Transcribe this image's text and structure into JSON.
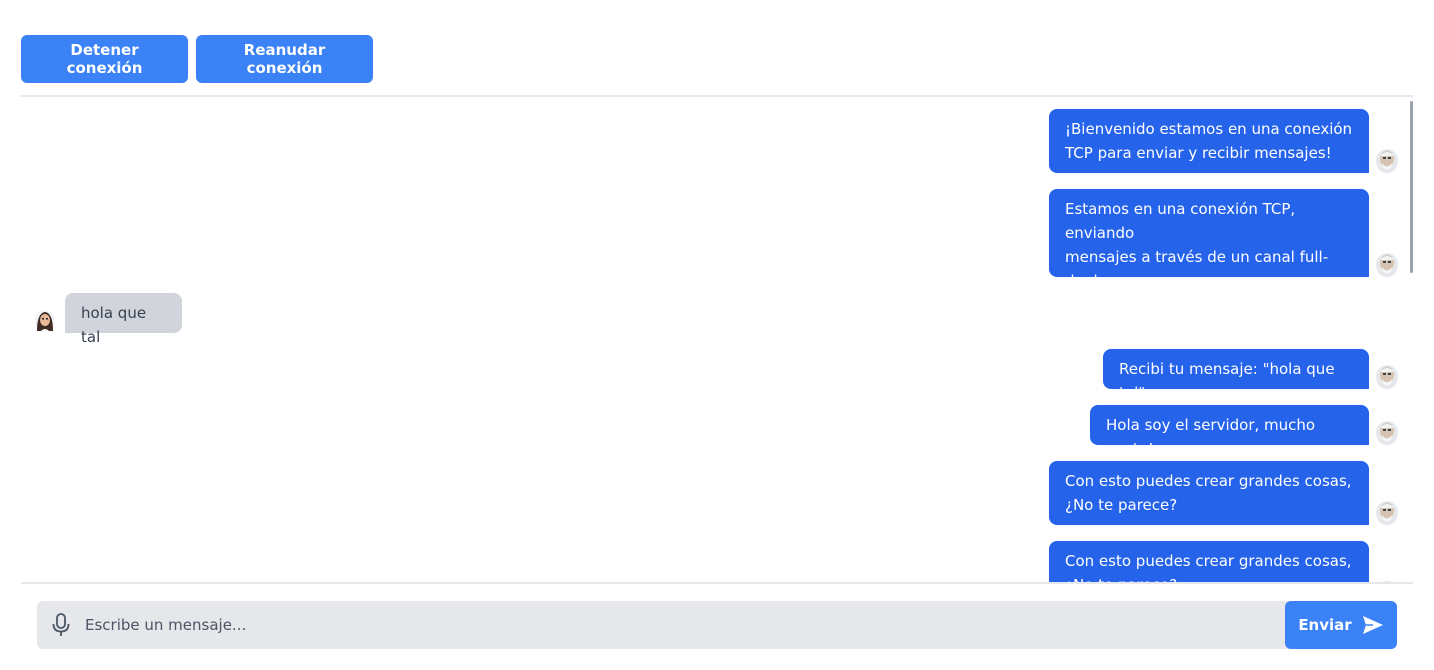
{
  "toolbar": {
    "stop_label": "Detener conexión",
    "resume_label": "Reanudar conexión"
  },
  "messages": [
    {
      "from": "server",
      "lines": [
        "¡Bienvenido estamos en una conexión",
        "TCP para enviar y recibir mensajes!"
      ]
    },
    {
      "from": "server",
      "lines": [
        "Estamos en una conexión TCP, enviando",
        "mensajes a través de un canal full-",
        "duplex"
      ]
    },
    {
      "from": "user",
      "lines": [
        "hola que tal"
      ]
    },
    {
      "from": "server",
      "lines": [
        "Recibi tu mensaje: \"hola que tal\""
      ]
    },
    {
      "from": "server",
      "lines": [
        "Hola soy el servidor, mucho gusto!"
      ]
    },
    {
      "from": "server",
      "lines": [
        "Con esto puedes crear grandes cosas,",
        "¿No te parece?"
      ]
    },
    {
      "from": "server",
      "lines": [
        "Con esto puedes crear grandes cosas,",
        "¿No te parece?"
      ]
    }
  ],
  "composer": {
    "placeholder": "Escribe un mensaje...",
    "send_label": "Enviar",
    "mic_icon": "microphone-icon",
    "send_icon": "send-arrow-icon"
  },
  "colors": {
    "button": "#3b82f6",
    "outgoing_bubble": "#2563eb",
    "incoming_bubble": "#d1d5db",
    "composer_bg": "#e5e7eb"
  }
}
